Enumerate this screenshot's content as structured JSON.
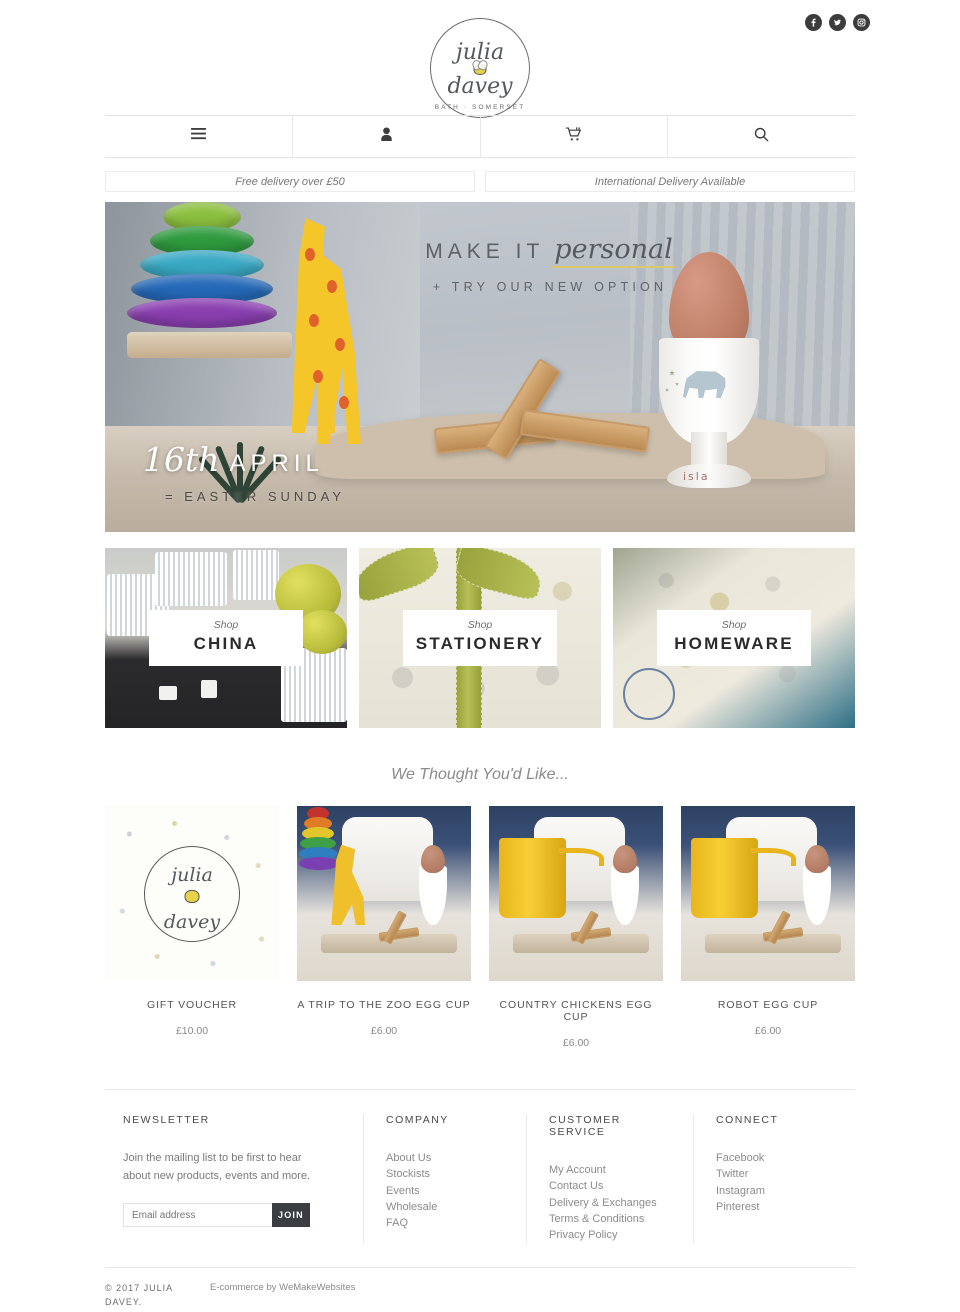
{
  "header": {
    "social": [
      {
        "name": "facebook-icon",
        "label": "Facebook"
      },
      {
        "name": "twitter-icon",
        "label": "Twitter"
      },
      {
        "name": "instagram-icon",
        "label": "Instagram"
      }
    ],
    "logo": {
      "line1": "julia",
      "line2": "davey",
      "sub": "BATH · SOMERSET",
      "bee": "bee-icon"
    }
  },
  "nav": {
    "items": [
      {
        "icon": "hamburger-menu-icon",
        "label": "Menu"
      },
      {
        "icon": "account-person-icon",
        "label": "Account"
      },
      {
        "icon": "shopping-cart-icon",
        "label": "Cart"
      },
      {
        "icon": "search-icon",
        "label": "Search"
      }
    ]
  },
  "promos": [
    {
      "text": "Free delivery over £50"
    },
    {
      "text": "International Delivery Available"
    }
  ],
  "hero": {
    "line1": "MAKE IT",
    "line2": "personal",
    "line3": "+ TRY OUR NEW OPTION",
    "date": "16th",
    "month": "APRIL",
    "occasion": "= EASTER SUNDAY",
    "personalisation": "isla",
    "underline_color": "#d9c96a"
  },
  "cards": [
    {
      "shop": "Shop",
      "name": "CHINA"
    },
    {
      "shop": "Shop",
      "name": "STATIONERY"
    },
    {
      "shop": "Shop",
      "name": "HOMEWARE"
    }
  ],
  "section": {
    "title": "We Thought You'd Like..."
  },
  "products": [
    {
      "name": "GIFT VOUCHER",
      "price": "£10.00"
    },
    {
      "name": "A TRIP TO THE ZOO EGG CUP",
      "price": "£6.00"
    },
    {
      "name": "COUNTRY CHICKENS EGG CUP",
      "price": "£6.00"
    },
    {
      "name": "ROBOT EGG CUP",
      "price": "£6.00"
    }
  ],
  "footer": {
    "newsletter": {
      "heading": "NEWSLETTER",
      "description": "Join the mailing list to be first to hear about new products, events and more.",
      "placeholder": "Email address",
      "value": "",
      "button": "JOIN"
    },
    "company": {
      "heading": "COMPANY",
      "links": [
        "About Us",
        "Stockists",
        "Events",
        "Wholesale",
        "FAQ"
      ]
    },
    "service": {
      "heading": "CUSTOMER SERVICE",
      "links": [
        "My Account",
        "Contact Us",
        "Delivery & Exchanges",
        "Terms & Conditions",
        "Privacy Policy"
      ]
    },
    "connect": {
      "heading": "CONNECT",
      "links": [
        "Facebook",
        "Twitter",
        "Instagram",
        "Pinterest"
      ]
    },
    "copyright": "© 2017 JULIA DAVEY.",
    "credit": "E-commerce by WeMakeWebsites"
  },
  "colors": {
    "text": "#4a4a4a",
    "muted": "#8c8c8c",
    "button": "#3a3d42",
    "border": "#e6e6e6"
  }
}
